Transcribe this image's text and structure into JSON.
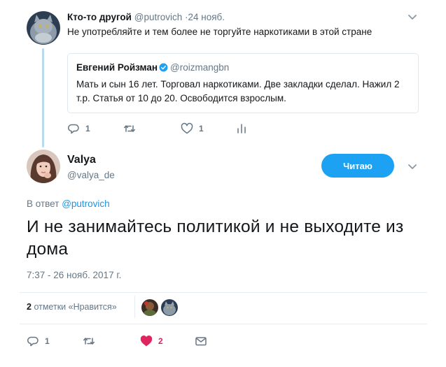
{
  "parent_tweet": {
    "name": "Кто-то другой",
    "handle": "@putrovich",
    "date": "·24 нояб.",
    "text": "Не употребляйте и тем более не торгуйте наркотиками в этой стране",
    "quote": {
      "name": "Евгений Ройзман",
      "handle": "@roizmangbn",
      "text": "Мать и сын 16 лет. Торговал наркотиками. Две закладки сделал. Нажил 2 т.р. Статья от 10 до 20. Освободится взрослым."
    },
    "actions": {
      "reply_count": "1",
      "retweet_count": "",
      "like_count": "1"
    }
  },
  "main_tweet": {
    "name": "Valya",
    "handle": "@valya_de",
    "follow_label": "Читаю",
    "reply_prefix": "В ответ",
    "reply_handle": "@putrovich",
    "text": "И не занимайтесь политикой и не выходите из дома",
    "timestamp": "7:37 - 26 нояб. 2017 г.",
    "likes_count": "2",
    "likes_label": "отметки «Нравится»",
    "actions": {
      "reply_count": "1",
      "retweet_count": "",
      "like_count": "2"
    }
  },
  "colors": {
    "accent": "#1da1f2",
    "link": "#1b95e0",
    "like_active": "#e0245e",
    "muted": "#657786",
    "thread_line": "#b8dbf0"
  },
  "icons": {
    "caret": "chevron-down-icon",
    "verified": "verified-badge-icon",
    "reply": "reply-icon",
    "retweet": "retweet-icon",
    "like": "heart-icon",
    "analytics": "analytics-icon",
    "dm": "envelope-icon"
  }
}
